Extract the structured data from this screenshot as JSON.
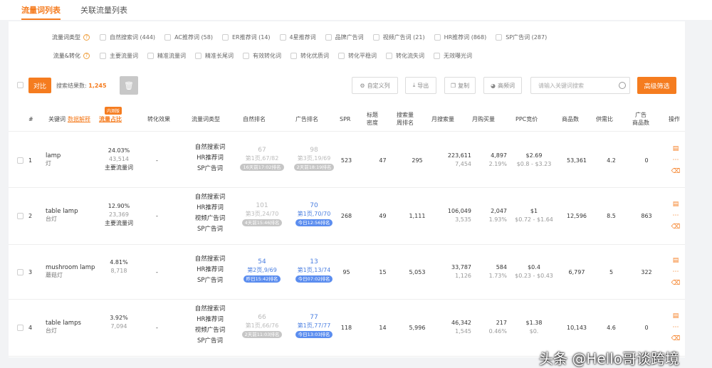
{
  "tabs": [
    "流量词列表",
    "关联流量列表"
  ],
  "filters": {
    "type_label": "流量词类型",
    "type_options": [
      "自然搜索词 (444)",
      "AC推荐词 (58)",
      "ER推荐词 (14)",
      "4星推荐词",
      "品牌广告词",
      "视频广告词 (21)",
      "HR推荐词 (868)",
      "SP广告词 (287)"
    ],
    "conv_label": "流量&转化",
    "conv_options": [
      "主要流量词",
      "精准流量词",
      "精准长尾词",
      "有效转化词",
      "转化优质词",
      "转化平稳词",
      "转化流失词",
      "无效曝光词"
    ]
  },
  "toolbar": {
    "compare": "对比",
    "result_label": "搜索结果数:",
    "result_count": "1,245",
    "custom_cols": "自定义列",
    "export": "导出",
    "copy": "复制",
    "high_freq": "高频词",
    "search_placeholder": "请输入关键词搜索",
    "advanced": "高级筛选"
  },
  "headers": {
    "num": "#",
    "keyword": "关键词",
    "data_explain": "数据解释",
    "beta": "内测版",
    "traffic_share": "流量占比",
    "conv_effect": "转化效果",
    "kw_type": "流量词类型",
    "organic_rank": "自然排名",
    "ad_rank": "广告排名",
    "spr": "SPR",
    "title_density": "标题\n密度",
    "search_vol_ratio": "搜索量\n周排名",
    "monthly_search": "月搜索量",
    "monthly_purchase": "月购买量",
    "ppc": "PPC竞价",
    "product_count": "商品数",
    "supply_demand": "供需比",
    "ad_products": "广告\n商品数",
    "ops": "操作"
  },
  "rows": [
    {
      "num": "1",
      "kw": "lamp",
      "kw_cn": "灯",
      "share": "24.03%",
      "share_sub": "43,514",
      "share_tag": "主要流量词",
      "conv": "-",
      "types": [
        "自然搜索词",
        "HR推荐词",
        "SP广告词"
      ],
      "org_rank": "67",
      "org_sub": "第1页,67/82",
      "org_pill": "16天前17:02排名",
      "org_pill_c": "g",
      "ad_rank": "98",
      "ad_sub": "第3页,19/69",
      "ad_pill": "2天前18:19排名",
      "ad_pill_c": "g",
      "spr": "523",
      "density": "47",
      "svr": "295",
      "msearch": "223,611",
      "msearch_sub": "7,454",
      "mbuy": "4,897",
      "mbuy_sub": "2.19%",
      "ppc": "$2.69",
      "ppc_sub": "$0.8 - $3.23",
      "products": "53,361",
      "sd": "4.2",
      "adp": "0"
    },
    {
      "num": "2",
      "kw": "table lamp",
      "kw_cn": "台灯",
      "share": "12.90%",
      "share_sub": "23,369",
      "share_tag": "主要流量词",
      "conv": "-",
      "types": [
        "自然搜索词",
        "HR推荐词",
        "视频广告词",
        "SP广告词"
      ],
      "org_rank": "101",
      "org_sub": "第3页,24/70",
      "org_pill": "4天前15:46排名",
      "org_pill_c": "g",
      "ad_rank": "70",
      "ad_sub": "第1页,70/70",
      "ad_pill": "今日12:56排名",
      "ad_pill_c": "b",
      "spr": "268",
      "density": "49",
      "svr": "1,111",
      "msearch": "106,049",
      "msearch_sub": "3,535",
      "mbuy": "2,047",
      "mbuy_sub": "1.93%",
      "ppc": "$1",
      "ppc_sub": "$0.72 - $1.64",
      "products": "12,596",
      "sd": "8.5",
      "adp": "863"
    },
    {
      "num": "3",
      "kw": "mushroom lamp",
      "kw_cn": "蘑菇灯",
      "share": "4.81%",
      "share_sub": "8,718",
      "share_tag": "",
      "conv": "-",
      "types": [
        "自然搜索词",
        "HR推荐词",
        "SP广告词"
      ],
      "org_rank": "54",
      "org_sub": "第2页,9/69",
      "org_pill": "昨日15:42排名",
      "org_pill_c": "b",
      "ad_rank": "13",
      "ad_sub": "第1页,13/74",
      "ad_pill": "今日07:02排名",
      "ad_pill_c": "b",
      "spr": "95",
      "density": "15",
      "svr": "5,053",
      "msearch": "33,787",
      "msearch_sub": "1,126",
      "mbuy": "584",
      "mbuy_sub": "1.73%",
      "ppc": "$0.4",
      "ppc_sub": "$0.23 - $0.43",
      "products": "6,797",
      "sd": "5",
      "adp": "322"
    },
    {
      "num": "4",
      "kw": "table lamps",
      "kw_cn": "台灯",
      "share": "3.92%",
      "share_sub": "7,094",
      "share_tag": "",
      "conv": "-",
      "types": [
        "自然搜索词",
        "HR推荐词",
        "视频广告词",
        "SP广告词"
      ],
      "org_rank": "66",
      "org_sub": "第1页,66/76",
      "org_pill": "2天前11:03排名",
      "org_pill_c": "g",
      "ad_rank": "77",
      "ad_sub": "第1页,77/77",
      "ad_pill": "今日13:03排名",
      "ad_pill_c": "b",
      "spr": "118",
      "density": "14",
      "svr": "5,996",
      "msearch": "46,342",
      "msearch_sub": "1,545",
      "mbuy": "217",
      "mbuy_sub": "0.46%",
      "ppc": "$1.38",
      "ppc_sub": "$0.",
      "products": "10,143",
      "sd": "4.6",
      "adp": "0"
    }
  ],
  "watermark": "头条 @Hello哥谈跨境",
  "colors": {
    "accent": "#f57c1f",
    "pill_blue": "#5b8def",
    "pill_gray": "#c6c6c6"
  }
}
